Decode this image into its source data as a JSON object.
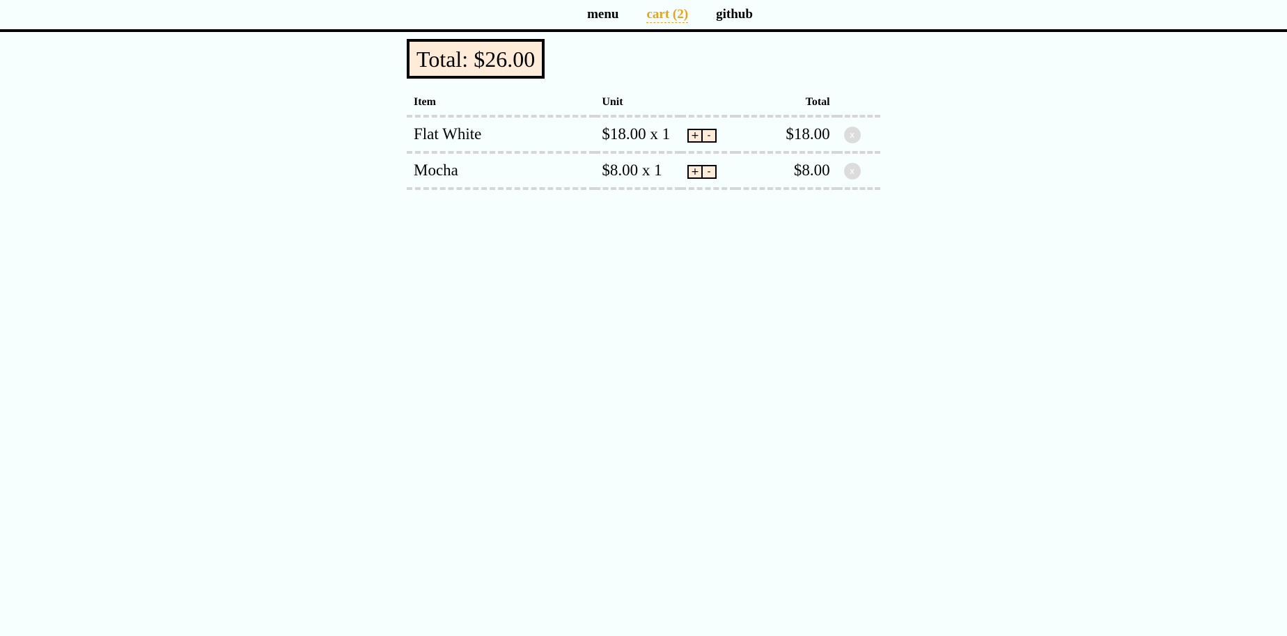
{
  "nav": {
    "menu": "menu",
    "cart": "cart (2)",
    "github": "github"
  },
  "total": {
    "label": "Total: $26.00"
  },
  "table": {
    "headers": {
      "item": "Item",
      "unit": "Unit",
      "total": "Total"
    },
    "rows": [
      {
        "item": "Flat White",
        "unit": "$18.00 x 1",
        "plus": "+",
        "minus": "-",
        "total": "$18.00",
        "remove": "x"
      },
      {
        "item": "Mocha",
        "unit": "$8.00 x 1",
        "plus": "+",
        "minus": "-",
        "total": "$8.00",
        "remove": "x"
      }
    ]
  },
  "colors": {
    "background": "#f7fffe",
    "accent": "#e8a417",
    "highlight": "#feecd8",
    "divider": "#d6d6d6"
  },
  "icons": {
    "remove": "close-icon"
  }
}
